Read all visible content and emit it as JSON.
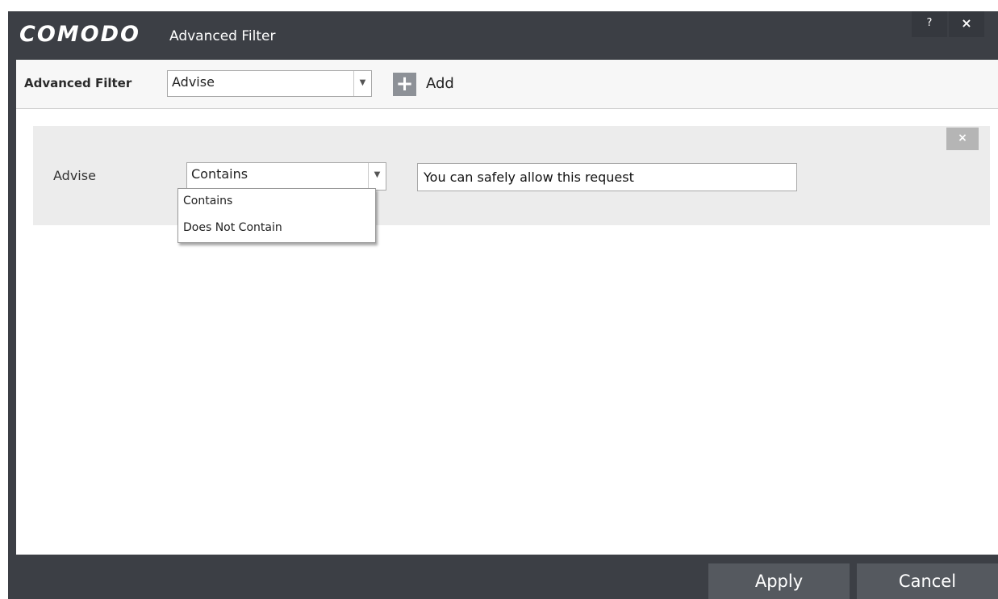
{
  "window": {
    "brand": "COMODO",
    "title": "Advanced Filter",
    "help_label": "?",
    "close_label": "×"
  },
  "filter_bar": {
    "label": "Advanced Filter",
    "selected": "Advise",
    "add_label": "Add",
    "add_icon": "plus-icon"
  },
  "rule": {
    "field_label": "Advise",
    "operator_selected": "Contains",
    "value": "You can safely allow this request",
    "remove_label": "×",
    "operator_options": [
      "Contains",
      "Does Not Contain"
    ]
  },
  "footer": {
    "apply_label": "Apply",
    "cancel_label": "Cancel"
  },
  "colors": {
    "window_frame": "#3c3f45",
    "button": "#55595f",
    "panel": "#ececec"
  }
}
